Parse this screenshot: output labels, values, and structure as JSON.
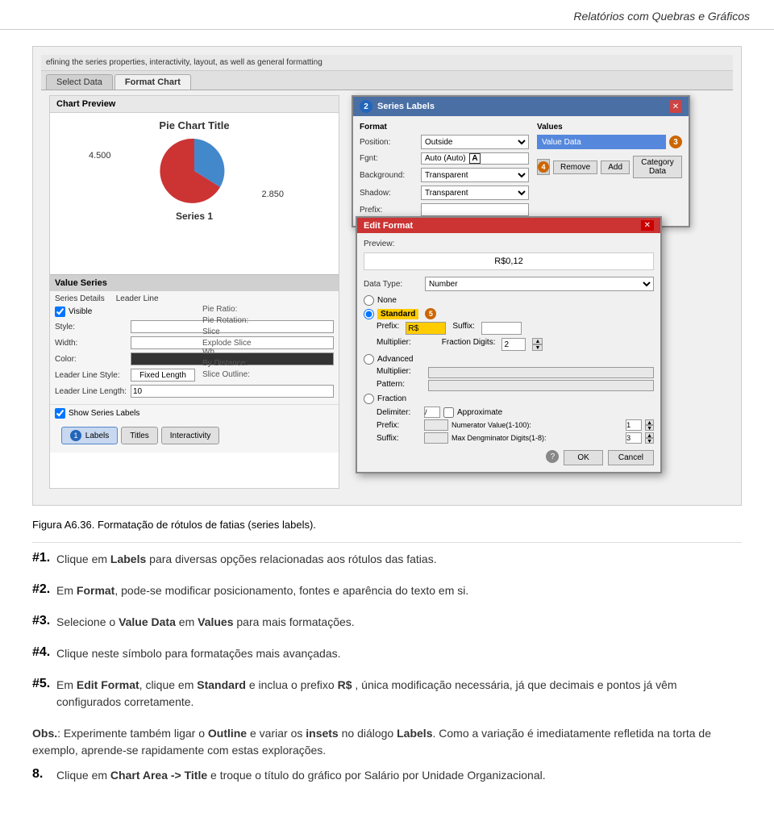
{
  "header": {
    "title": "Relatórios com Quebras e Gráficos"
  },
  "screenshot": {
    "top_text": "efining the series properties, interactivity, layout, as well as general formatting",
    "tabs": [
      {
        "label": "Select Data",
        "active": false
      },
      {
        "label": "Format Chart",
        "active": true
      }
    ],
    "chart_preview": {
      "title": "Chart Preview",
      "pie_chart_title": "Pie Chart Title",
      "label_1": "4.500",
      "label_2": "2.850",
      "series_label": "Series 1"
    },
    "value_series": {
      "title": "Value Series",
      "fields": {
        "series_details": "Series Details",
        "leader_line": "Leader Line",
        "visible_label": "Visible",
        "style_label": "Style:",
        "width_label": "Width:",
        "color_label": "Color:",
        "leader_line_style": "Leader Line Style:",
        "fixed_length": "Fixed Length",
        "leader_line_length": "Leader Line Length:",
        "length_value": "10"
      },
      "right_fields": {
        "pie_ratio": "Pie Ratio:",
        "pie_rotation": "Pie Rotation:",
        "slice_label": "Slice",
        "explode_slice": "Explode Slice Wh",
        "by_distance": "By Distance:",
        "slice_outline": "Slice Outline:"
      },
      "show_series_labels": "Show Series Labels",
      "buttons": [
        {
          "label": "Labels",
          "active": true,
          "badge": "1"
        },
        {
          "label": "Titles",
          "active": false
        },
        {
          "label": "Interactivity",
          "active": false
        }
      ]
    },
    "series_labels_dialog": {
      "title": "Series Labels",
      "badge": "2",
      "fields": {
        "format_label": "Format",
        "position_label": "Position:",
        "position_value": "Outside",
        "font_label": "Fgnt:",
        "font_value": "Auto (Auto)",
        "background_label": "Background:",
        "background_value": "Transparent",
        "shadow_label": "Shadow:",
        "shadow_value": "Transparent",
        "prefix_label": "Prefix:"
      },
      "values_section": {
        "label": "Values",
        "value_data": "Value Data",
        "badge": "3"
      },
      "buttons": {
        "icon": "4",
        "remove": "Remove",
        "add": "Add",
        "category_data": "Category Data"
      }
    },
    "edit_format_dialog": {
      "title": "Edit Format",
      "preview_label": "Preview:",
      "preview_value": "R$0,12",
      "data_type_label": "Data Type:",
      "data_type_value": "Number",
      "options": {
        "none": "None",
        "standard": "Standard",
        "badge": "5",
        "prefix_label": "Prefix:",
        "prefix_value": "R$",
        "suffix_label": "Suffix:",
        "suffix_value": "",
        "multiplier_label": "Multiplier:",
        "fraction_label": "Fraction Digits:",
        "fraction_value": "2",
        "advanced": "Advanced",
        "multiplier_field": "Multiplier:",
        "pattern_field": "Pattern:",
        "fraction": "Fraction",
        "delimiter_label": "Delimiter:",
        "delimiter_value": "/",
        "approximate": "Approximate",
        "prefix2_label": "Prefix:",
        "numerator_label": "Numerator Value(1-100):",
        "numerator_value": "1",
        "suffix2_label": "Suffix:",
        "max_denom_label": "Max Dengminator Digits(1-8):",
        "max_denom_value": "3"
      },
      "buttons": {
        "ok": "OK",
        "cancel": "Cancel"
      }
    }
  },
  "figure_caption": "Figura A6.36. Formatação de rótulos de fatias (series labels).",
  "instructions": [
    {
      "number": "#1.",
      "text": "Clique em Labels para diversas opções relacionadas aos rótulos das fatias."
    },
    {
      "number": "#2.",
      "text": "Em Format, pode-se modificar posicionamento, fontes e aparência do texto em si."
    },
    {
      "number": "#3.",
      "text": "Selecione o Value Data em Values para mais formatações."
    },
    {
      "number": "#4.",
      "text": "Clique neste símbolo para formatações mais avançadas."
    },
    {
      "number": "#5.",
      "text": "Em Edit Format, clique em Standard e inclua o prefixo R$ , única modificação necessária, já que decimais e pontos já vêm configurados corretamente."
    }
  ],
  "obs": {
    "label": "Obs.",
    "text": ": Experimente também ligar o Outline e variar os insets no diálogo Labels. Como a variação é imediatamente refletida na torta de exemplo, aprende-se rapidamente com estas explorações."
  },
  "footer_item": {
    "number": "8.",
    "text": "Clique em Chart Area -> Title e troque o título do gráfico por Salário por Unidade Organizacional."
  }
}
